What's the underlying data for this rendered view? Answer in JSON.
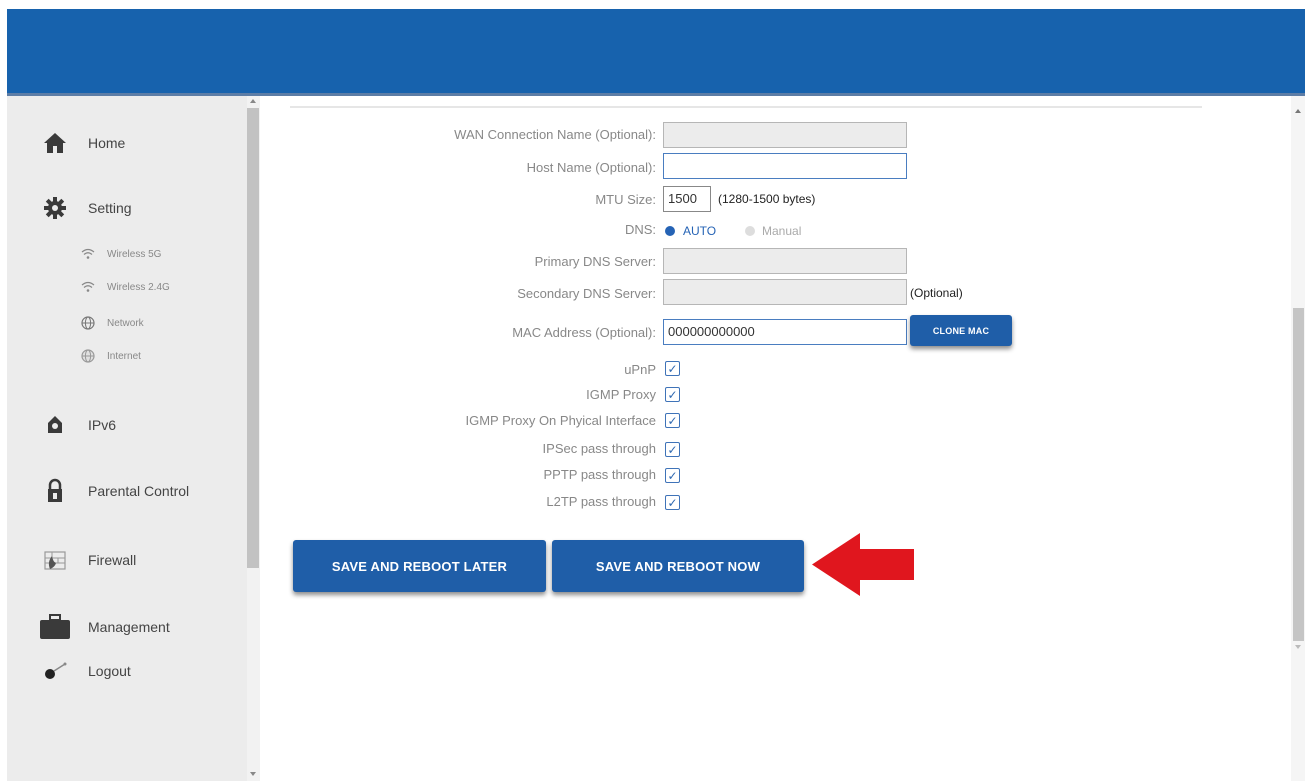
{
  "sidebar": {
    "items": [
      {
        "label": "Home",
        "icon": "home-icon"
      },
      {
        "label": "Setting",
        "icon": "gear-icon"
      },
      {
        "label": "IPv6",
        "icon": "ipv6-icon"
      },
      {
        "label": "Parental Control",
        "icon": "lock-icon"
      },
      {
        "label": "Firewall",
        "icon": "firewall-icon"
      },
      {
        "label": "Management",
        "icon": "briefcase-icon"
      },
      {
        "label": "Logout",
        "icon": "logout-icon"
      }
    ],
    "sub_items": [
      {
        "label": "Wireless 5G",
        "icon": "wifi-icon"
      },
      {
        "label": "Wireless 2.4G",
        "icon": "wifi-icon"
      },
      {
        "label": "Network",
        "icon": "globe-icon"
      },
      {
        "label": "Internet",
        "icon": "globe-icon"
      }
    ]
  },
  "form": {
    "wan_name_label": "WAN Connection Name (Optional):",
    "wan_name_value": "",
    "host_name_label": "Host Name (Optional):",
    "host_name_value": "",
    "mtu_label": "MTU Size:",
    "mtu_value": "1500",
    "mtu_hint": "(1280-1500 bytes)",
    "dns_label": "DNS:",
    "dns_options": [
      "AUTO",
      "Manual"
    ],
    "dns_selected": "AUTO",
    "primary_dns_label": "Primary DNS Server:",
    "primary_dns_value": "",
    "secondary_dns_label": "Secondary DNS Server:",
    "secondary_dns_value": "",
    "secondary_dns_hint": "(Optional)",
    "mac_label": "MAC Address (Optional):",
    "mac_value": "000000000000",
    "clone_mac_label": "CLONE MAC",
    "checkboxes": [
      {
        "label": "uPnP",
        "checked": true
      },
      {
        "label": "IGMP Proxy",
        "checked": true
      },
      {
        "label": "IGMP Proxy On Phyical Interface",
        "checked": true
      },
      {
        "label": "IPSec pass through",
        "checked": true
      },
      {
        "label": "PPTP pass through",
        "checked": true
      },
      {
        "label": "L2TP pass through",
        "checked": true
      }
    ]
  },
  "buttons": {
    "save_later": "SAVE AND REBOOT LATER",
    "save_now": "SAVE AND REBOOT NOW"
  },
  "colors": {
    "header": "#1762ad",
    "button": "#1f5ea8",
    "arrow": "#e0161e",
    "sidebar": "#ececec"
  }
}
